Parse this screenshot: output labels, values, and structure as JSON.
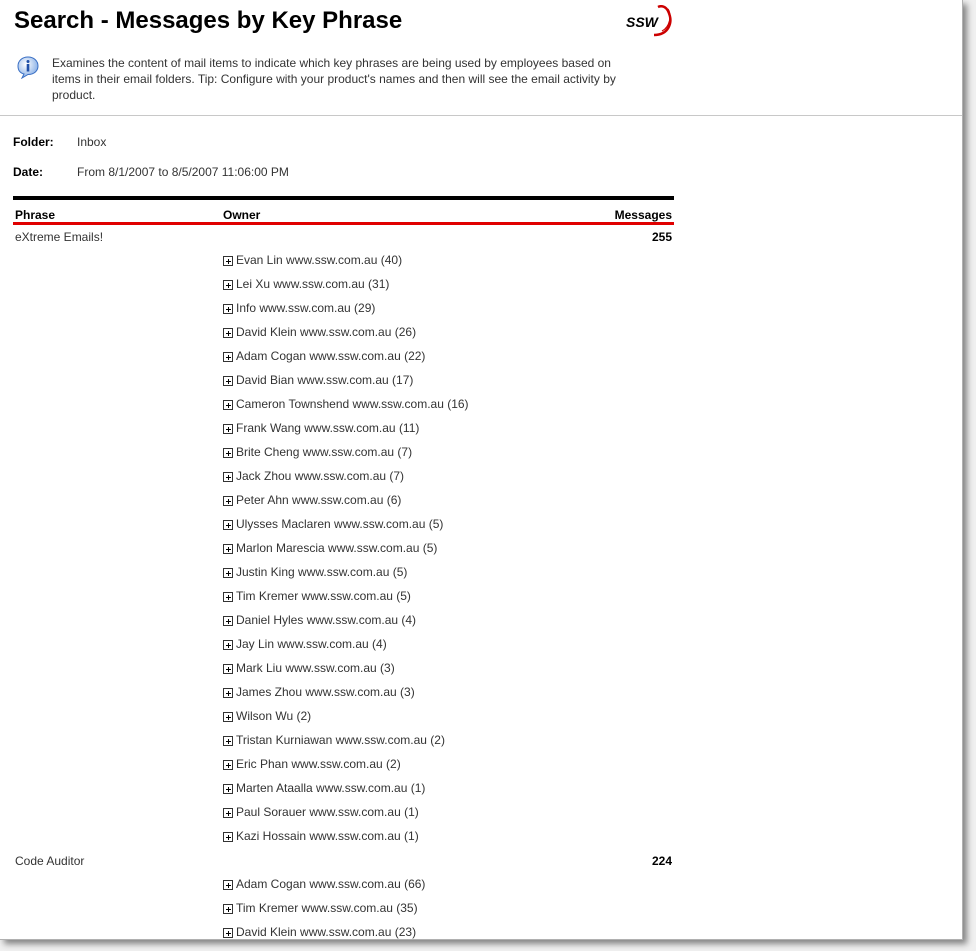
{
  "page": {
    "title": "Search - Messages by Key Phrase",
    "description": "Examines the content of mail items to indicate which key phrases are being used by employees based on items in their email folders. Tip: Configure with your product's names and then will see the email activity by product."
  },
  "logo": {
    "text": "SSW",
    "color": "#cc0000"
  },
  "filters": {
    "folder_label": "Folder:",
    "folder_value": "Inbox",
    "date_label": "Date:",
    "date_value": "From 8/1/2007 to 8/5/2007 11:06:00 PM"
  },
  "table": {
    "headers": {
      "phrase": "Phrase",
      "owner": "Owner",
      "messages": "Messages"
    },
    "groups": [
      {
        "phrase": "eXtreme Emails!",
        "count": "255",
        "owners": [
          "Evan Lin www.ssw.com.au (40)",
          "Lei Xu www.ssw.com.au (31)",
          "Info www.ssw.com.au (29)",
          "David Klein www.ssw.com.au (26)",
          "Adam Cogan www.ssw.com.au (22)",
          "David Bian www.ssw.com.au (17)",
          "Cameron Townshend www.ssw.com.au (16)",
          "Frank Wang www.ssw.com.au (11)",
          "Brite Cheng www.ssw.com.au (7)",
          "Jack Zhou www.ssw.com.au (7)",
          "Peter Ahn www.ssw.com.au (6)",
          "Ulysses Maclaren www.ssw.com.au (5)",
          "Marlon Marescia www.ssw.com.au (5)",
          "Justin King www.ssw.com.au (5)",
          "Tim Kremer www.ssw.com.au (5)",
          "Daniel Hyles www.ssw.com.au (4)",
          "Jay Lin www.ssw.com.au (4)",
          "Mark Liu www.ssw.com.au (3)",
          "James Zhou www.ssw.com.au (3)",
          "Wilson Wu (2)",
          "Tristan Kurniawan www.ssw.com.au (2)",
          "Eric Phan www.ssw.com.au (2)",
          "Marten Ataalla www.ssw.com.au (1)",
          "Paul Sorauer www.ssw.com.au (1)",
          "Kazi Hossain www.ssw.com.au (1)"
        ]
      },
      {
        "phrase": "Code Auditor",
        "count": "224",
        "owners": [
          "Adam Cogan www.ssw.com.au (66)",
          "Tim Kremer www.ssw.com.au (35)",
          "David Klein www.ssw.com.au (23)"
        ]
      }
    ]
  },
  "colors": {
    "accent_red": "#e00000",
    "rule_black": "#000000"
  }
}
